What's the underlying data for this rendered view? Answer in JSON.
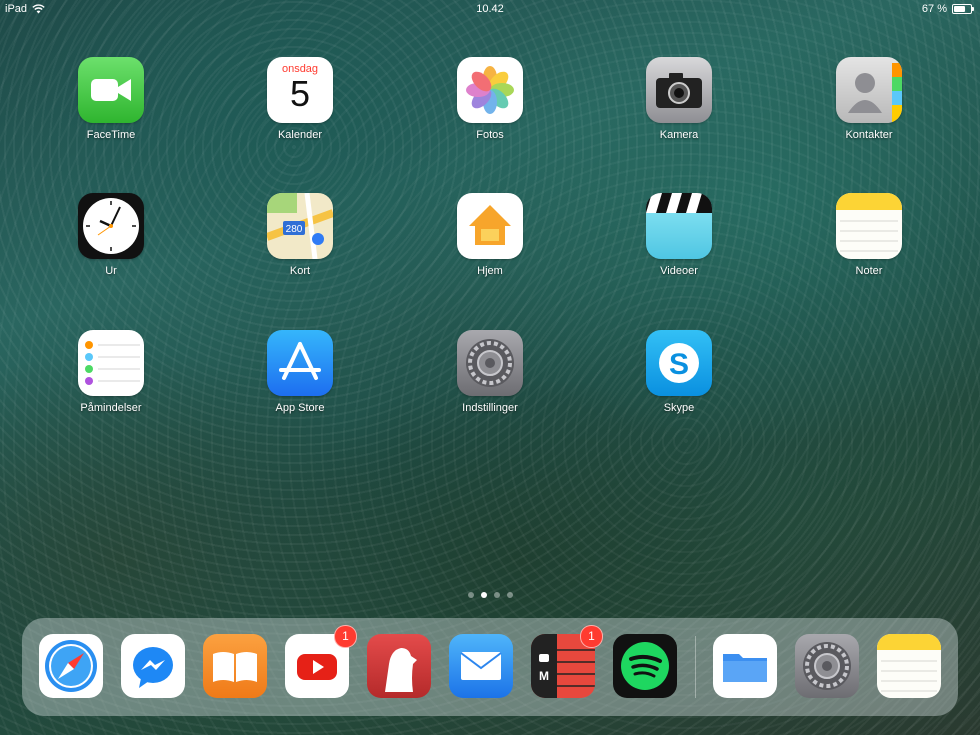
{
  "status_bar": {
    "device": "iPad",
    "time": "10.42",
    "battery": "67 %",
    "battery_level": 0.67
  },
  "home_apps": [
    {
      "name": "FaceTime",
      "icon": "facetime-icon"
    },
    {
      "name": "Kalender",
      "icon": "calendar-icon",
      "weekday": "onsdag",
      "day": "5"
    },
    {
      "name": "Fotos",
      "icon": "photos-icon"
    },
    {
      "name": "Kamera",
      "icon": "camera-icon"
    },
    {
      "name": "Kontakter",
      "icon": "contacts-icon"
    },
    {
      "name": "Ur",
      "icon": "clock-icon"
    },
    {
      "name": "Kort",
      "icon": "maps-icon",
      "route": "280"
    },
    {
      "name": "Hjem",
      "icon": "home-icon"
    },
    {
      "name": "Videoer",
      "icon": "videos-icon"
    },
    {
      "name": "Noter",
      "icon": "notes-icon"
    },
    {
      "name": "Påmindelser",
      "icon": "reminders-icon"
    },
    {
      "name": "App Store",
      "icon": "appstore-icon"
    },
    {
      "name": "Indstillinger",
      "icon": "settings-icon"
    },
    {
      "name": "Skype",
      "icon": "skype-icon"
    }
  ],
  "page_dots": {
    "count": 4,
    "active": 1
  },
  "dock_apps": [
    {
      "icon": "safari-icon"
    },
    {
      "icon": "messenger-icon"
    },
    {
      "icon": "books-icon"
    },
    {
      "icon": "youtube-icon",
      "badge": "1"
    },
    {
      "icon": "bear-icon"
    },
    {
      "icon": "mail-icon"
    },
    {
      "icon": "momentum-icon",
      "badge": "1",
      "mark": "M"
    },
    {
      "icon": "spotify-icon"
    },
    {
      "icon": "files-icon"
    },
    {
      "icon": "settings-icon"
    },
    {
      "icon": "notes-icon"
    }
  ]
}
